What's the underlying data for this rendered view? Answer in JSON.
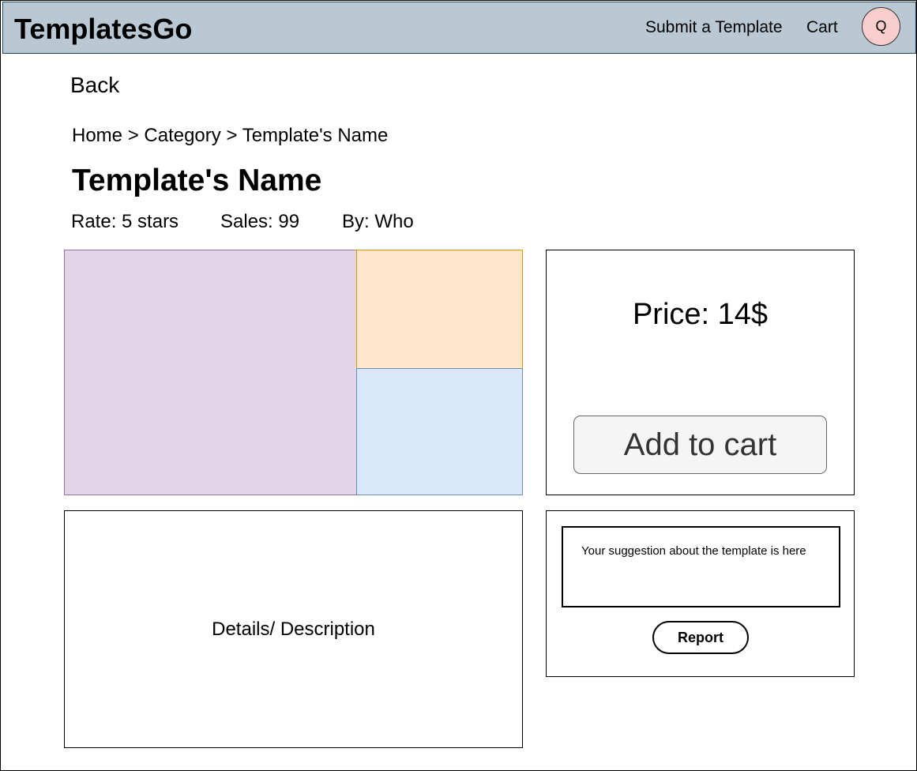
{
  "header": {
    "logo": "TemplatesGo",
    "nav": {
      "submit_label": "Submit a Template",
      "cart_label": "Cart"
    },
    "avatar_initial": "Q"
  },
  "back_label": "Back",
  "breadcrumb": {
    "home": "Home",
    "separator": ">",
    "category": "Category",
    "current": "Template's Name"
  },
  "template": {
    "name": "Template's Name",
    "rate": "Rate: 5 stars",
    "sales": "Sales: 99",
    "by": "By: Who"
  },
  "purchase": {
    "price": "Price: 14$",
    "add_to_cart_label": "Add to cart"
  },
  "details": {
    "text": "Details/ Description"
  },
  "report": {
    "placeholder": "Your suggestion about the template is here",
    "button_label": "Report"
  },
  "colors": {
    "header_bg": "#bac8d3",
    "avatar_bg": "#f8cecc",
    "preview_main": "#e1d5e7",
    "preview_top": "#ffe6cc",
    "preview_bottom": "#dae8fc"
  }
}
